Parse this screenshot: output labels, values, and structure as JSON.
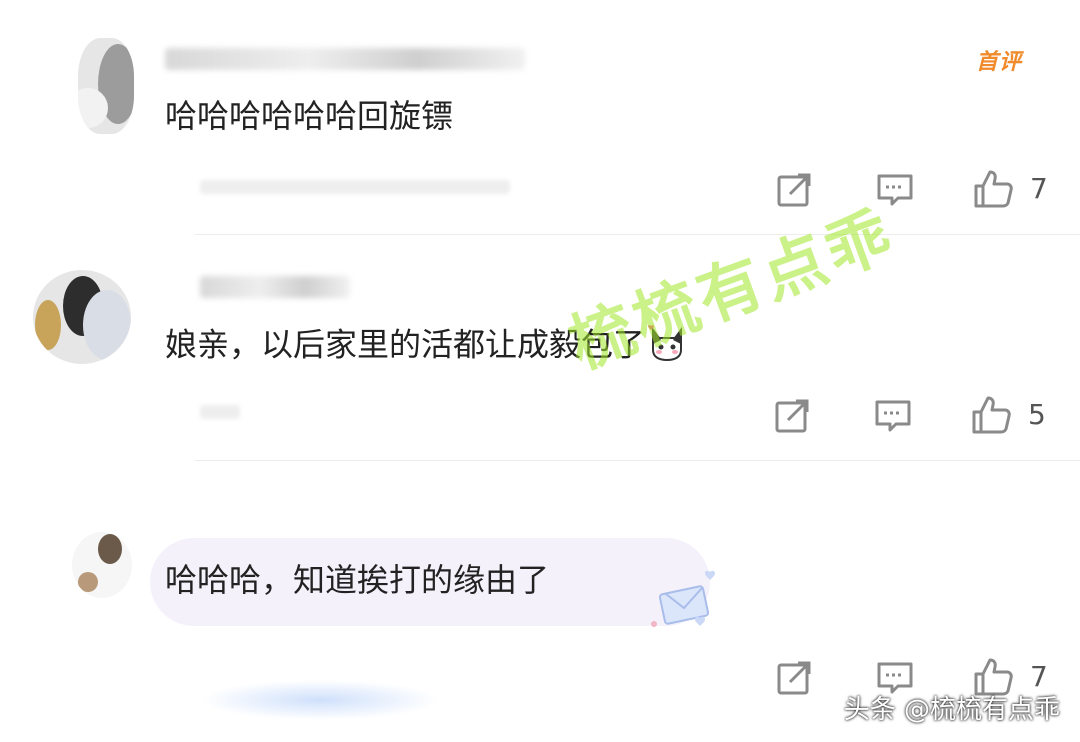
{
  "comments": [
    {
      "text": "哈哈哈哈哈哈回旋镖",
      "badge": "首评",
      "like_count": "7"
    },
    {
      "text": "娘亲，以后家里的活都让成毅包了",
      "emoji": "cat-face",
      "like_count": "5"
    },
    {
      "text": "哈哈哈，知道挨打的缘由了",
      "like_count": "7"
    }
  ],
  "watermark": "梳梳有点乖",
  "credit": "头条 @梳梳有点乖",
  "icons": {
    "share": "share-icon",
    "reply": "reply-icon",
    "like": "thumbs-up-icon"
  },
  "colors": {
    "badge": "#f08a2b",
    "watermark": "#a0e628",
    "icon": "#8a8a8a"
  }
}
